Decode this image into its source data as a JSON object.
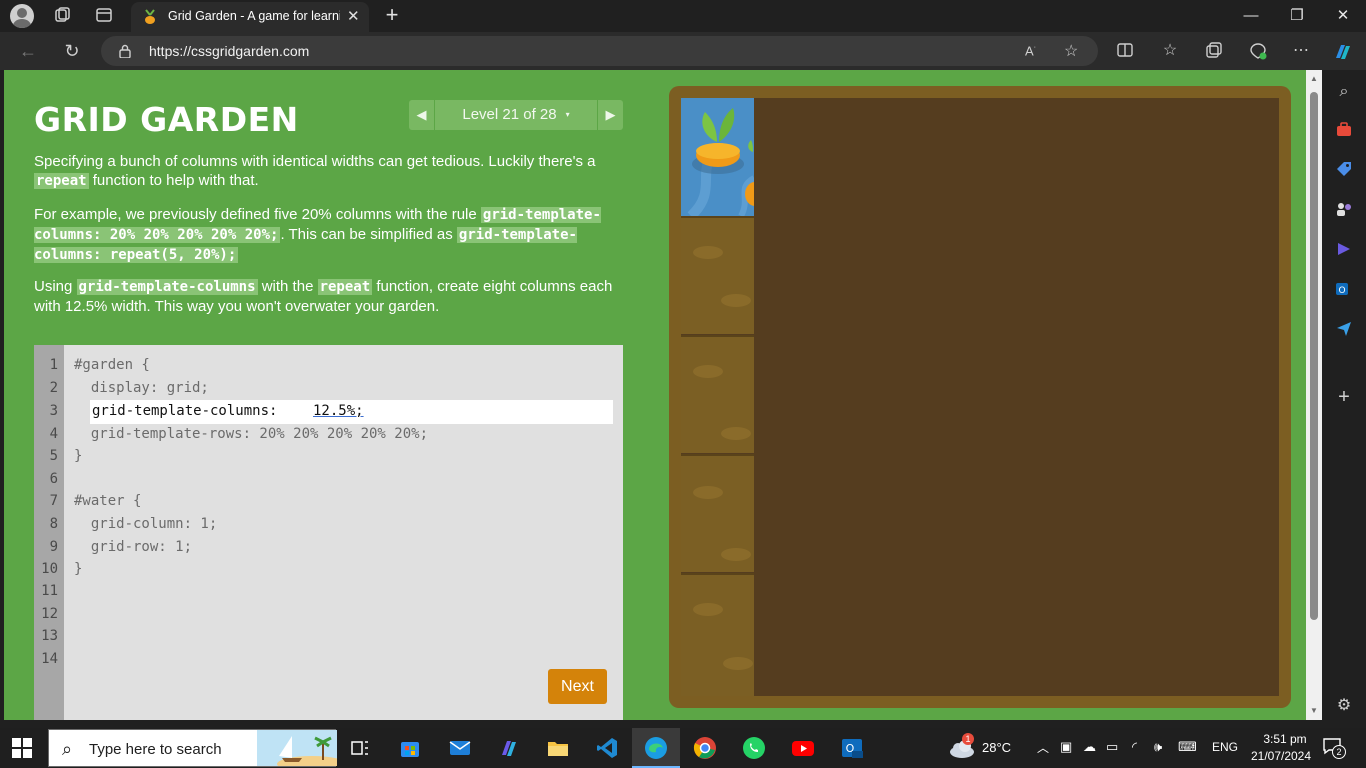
{
  "browser": {
    "tab_title": "Grid Garden - A game for learnin",
    "tab_close": "✕",
    "new_tab": "+",
    "url": "https://cssgridgarden.com",
    "window_controls": {
      "minimize": "—",
      "maximize": "❐",
      "close": "✕"
    }
  },
  "game": {
    "title": "GRID GARDEN",
    "level_label": "Level 21 of 28",
    "level_caret": "▾",
    "prev_arrow": "◀",
    "next_arrow": "▶",
    "instructions": {
      "p1_a": "Specifying a bunch of columns with identical widths can get tedious. Luckily there's a ",
      "p1_code": "repeat",
      "p1_b": " function to help with that.",
      "p2_a": "For example, we previously defined five 20% columns with the rule ",
      "p2_code1": "grid-template-columns: 20% 20% 20% 20% 20%;",
      "p2_b": ". This can be simplified as ",
      "p2_code2": "grid-template-columns: repeat(5, 20%);",
      "p3_a": "Using ",
      "p3_code1": "grid-template-columns",
      "p3_b": " with the ",
      "p3_code2": "repeat",
      "p3_c": " function, create eight columns each with 12.5% width. This way you won't overwater your garden."
    },
    "editor": {
      "line_numbers": [
        "1",
        "2",
        "3",
        "4",
        "5",
        "6",
        "7",
        "8",
        "9",
        "10",
        "11",
        "12",
        "13",
        "14"
      ],
      "line1": "#garden {",
      "line2": "  display: grid;",
      "input_prefix": "grid-template-columns: ",
      "input_value": "12.5%;",
      "line4": "  grid-template-rows: 20% 20% 20% 20% 20%;",
      "line5": "}",
      "line7": "#water {",
      "line8": "  grid-column: 1;",
      "line9": "  grid-row: 1;",
      "line10": "}"
    },
    "next_button": "Next"
  },
  "taskbar": {
    "search_placeholder": "Type here to search",
    "weather_temp": "28°C",
    "weather_alert": "1",
    "language": "ENG",
    "time": "3:51 pm",
    "date": "21/07/2024",
    "notification_count": "2"
  },
  "colors": {
    "page_green": "#5ca646",
    "code_highlight": "#8ac476",
    "next_button": "#d4830a",
    "garden_border": "#7c5e22",
    "garden_soil": "#553d1f",
    "water": "#4a8fc7"
  }
}
